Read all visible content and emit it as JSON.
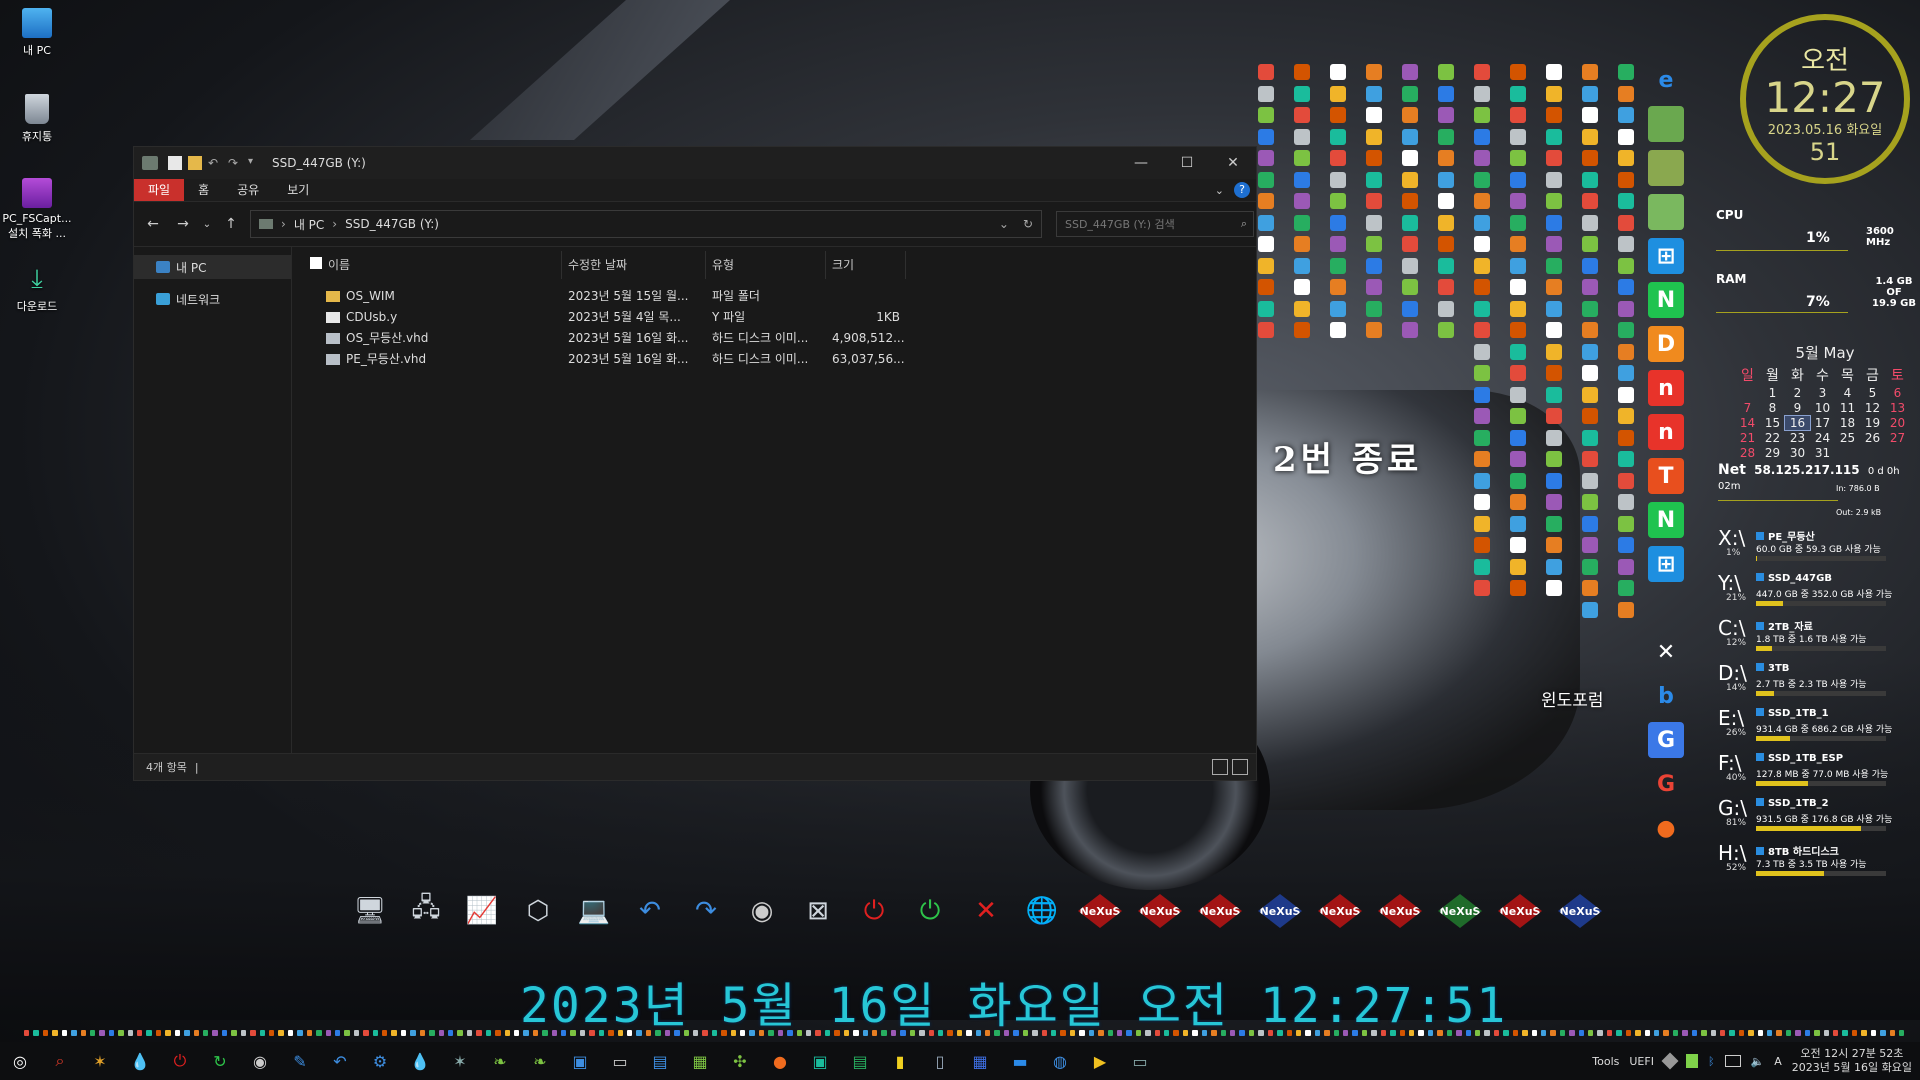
{
  "desktop": {
    "icons": [
      {
        "label": "내 PC"
      },
      {
        "label": "휴지통"
      },
      {
        "label": "PC_FSCapt... 설치 폭화 ..."
      },
      {
        "label": "다운로드"
      }
    ],
    "overlay_text": "2번 종료",
    "overlay_text_small": "윈도포럼"
  },
  "explorer": {
    "title": "SSD_447GB (Y:)",
    "window_controls": {
      "minimize": "—",
      "maximize": "☐",
      "close": "✕"
    },
    "ribbon_tabs": [
      "파일",
      "홈",
      "공유",
      "보기"
    ],
    "active_tab": "파일",
    "help_label": "?",
    "address": {
      "segments": [
        "내 PC",
        "SSD_447GB (Y:)"
      ],
      "separator": "›"
    },
    "search_placeholder": "SSD_447GB (Y:) 검색",
    "nav_items": [
      {
        "label": "내 PC",
        "selected": true,
        "color": "#3b82c4"
      },
      {
        "label": "네트워크",
        "selected": false,
        "color": "#3aa0d8"
      }
    ],
    "columns": [
      "이름",
      "수정한 날짜",
      "유형",
      "크기"
    ],
    "files": [
      {
        "name": "OS_WIM",
        "date": "2023년 5월 15일 월...",
        "type": "파일 폴더",
        "size": "",
        "icon": "folder-icon"
      },
      {
        "name": "CDUsb.y",
        "date": "2023년 5월 4일 목...",
        "type": "Y 파일",
        "size": "1KB",
        "icon": "file-icon"
      },
      {
        "name": "OS_무등산.vhd",
        "date": "2023년 5월 16일 화...",
        "type": "하드 디스크 이미...",
        "size": "4,908,512...",
        "icon": "vhd-icon"
      },
      {
        "name": "PE_무등산.vhd",
        "date": "2023년 5월 16일 화...",
        "type": "하드 디스크 이미...",
        "size": "63,037,56...",
        "icon": "vhd-icon"
      }
    ],
    "status": "4개 항목"
  },
  "clock": {
    "ampm": "오전",
    "time": "12:27",
    "date": "2023.05.16 화요일",
    "seconds": "51"
  },
  "monitor": {
    "cpu_label": "CPU",
    "cpu_pct": "1%",
    "cpu_freq": "3600 MHz",
    "ram_label": "RAM",
    "ram_pct": "7%",
    "ram_used": "1.4 GB",
    "ram_of": "OF",
    "ram_total": "19.9 GB"
  },
  "calendar": {
    "title": "5월 May",
    "weekdays": [
      "일",
      "월",
      "화",
      "수",
      "목",
      "금",
      "토"
    ],
    "weeks": [
      [
        "",
        "1",
        "2",
        "3",
        "4",
        "5",
        "6"
      ],
      [
        "7",
        "8",
        "9",
        "10",
        "11",
        "12",
        "13"
      ],
      [
        "14",
        "15",
        "16",
        "17",
        "18",
        "19",
        "20"
      ],
      [
        "21",
        "22",
        "23",
        "24",
        "25",
        "26",
        "27"
      ],
      [
        "28",
        "29",
        "30",
        "31",
        "",
        "",
        ""
      ]
    ],
    "today": "16"
  },
  "net": {
    "label": "Net",
    "ip": "58.125.217.115",
    "uptime": "0 d 0h 02m",
    "in": "In: 786.0 B",
    "out": "Out: 2.9 kB"
  },
  "drives": [
    {
      "letter": "X:\\",
      "name": "PE_무등산",
      "info": "60.0 GB 중 59.3 GB 사용 가능",
      "pct": "1%",
      "fill": 0.01
    },
    {
      "letter": "Y:\\",
      "name": "SSD_447GB",
      "info": "447.0 GB 중 352.0 GB 사용 가능",
      "pct": "21%",
      "fill": 0.21
    },
    {
      "letter": "C:\\",
      "name": "2TB_자료",
      "info": "1.8 TB 중 1.6 TB 사용 가능",
      "pct": "12%",
      "fill": 0.12
    },
    {
      "letter": "D:\\",
      "name": "3TB",
      "info": "2.7 TB 중 2.3 TB 사용 가능",
      "pct": "14%",
      "fill": 0.14
    },
    {
      "letter": "E:\\",
      "name": "SSD_1TB_1",
      "info": "931.4 GB 중 686.2 GB 사용 가능",
      "pct": "26%",
      "fill": 0.26
    },
    {
      "letter": "F:\\",
      "name": "SSD_1TB_ESP",
      "info": "127.8 MB 중 77.0 MB 사용 가능",
      "pct": "40%",
      "fill": 0.4
    },
    {
      "letter": "G:\\",
      "name": "SSD_1TB_2",
      "info": "931.5 GB 중 176.8 GB 사용 가능",
      "pct": "81%",
      "fill": 0.81
    },
    {
      "letter": "H:\\",
      "name": "8TB 하드디스크",
      "info": "7.3 TB 중 3.5 TB 사용 가능",
      "pct": "52%",
      "fill": 0.52
    }
  ],
  "dock": {
    "nexus_label": "NeXuS",
    "items": [
      "monitor-icon",
      "network-icon",
      "chart-icon",
      "cube-icon",
      "laptop-icon",
      "undo-icon",
      "redo-icon",
      "speaker-icon",
      "disconnect-icon",
      "power-red-icon",
      "power-green-icon",
      "close-x-icon",
      "globe-pc-icon"
    ]
  },
  "date_banner": "2023년 5월 16일 화요일 오전 12:27:51",
  "taskbar": {
    "tray_text_tools": "Tools",
    "tray_text_uefi": "UEFI",
    "tray_ime": "A",
    "clock_line1": "오전 12시 27분 52초",
    "clock_line2": "2023년 5월 16일 화요일"
  },
  "colors": {
    "accent_red": "#c9302c",
    "clock_gold": "#a6a21e",
    "banner_cyan": "#27c6d6",
    "drive_bar": "#e0c21d"
  }
}
